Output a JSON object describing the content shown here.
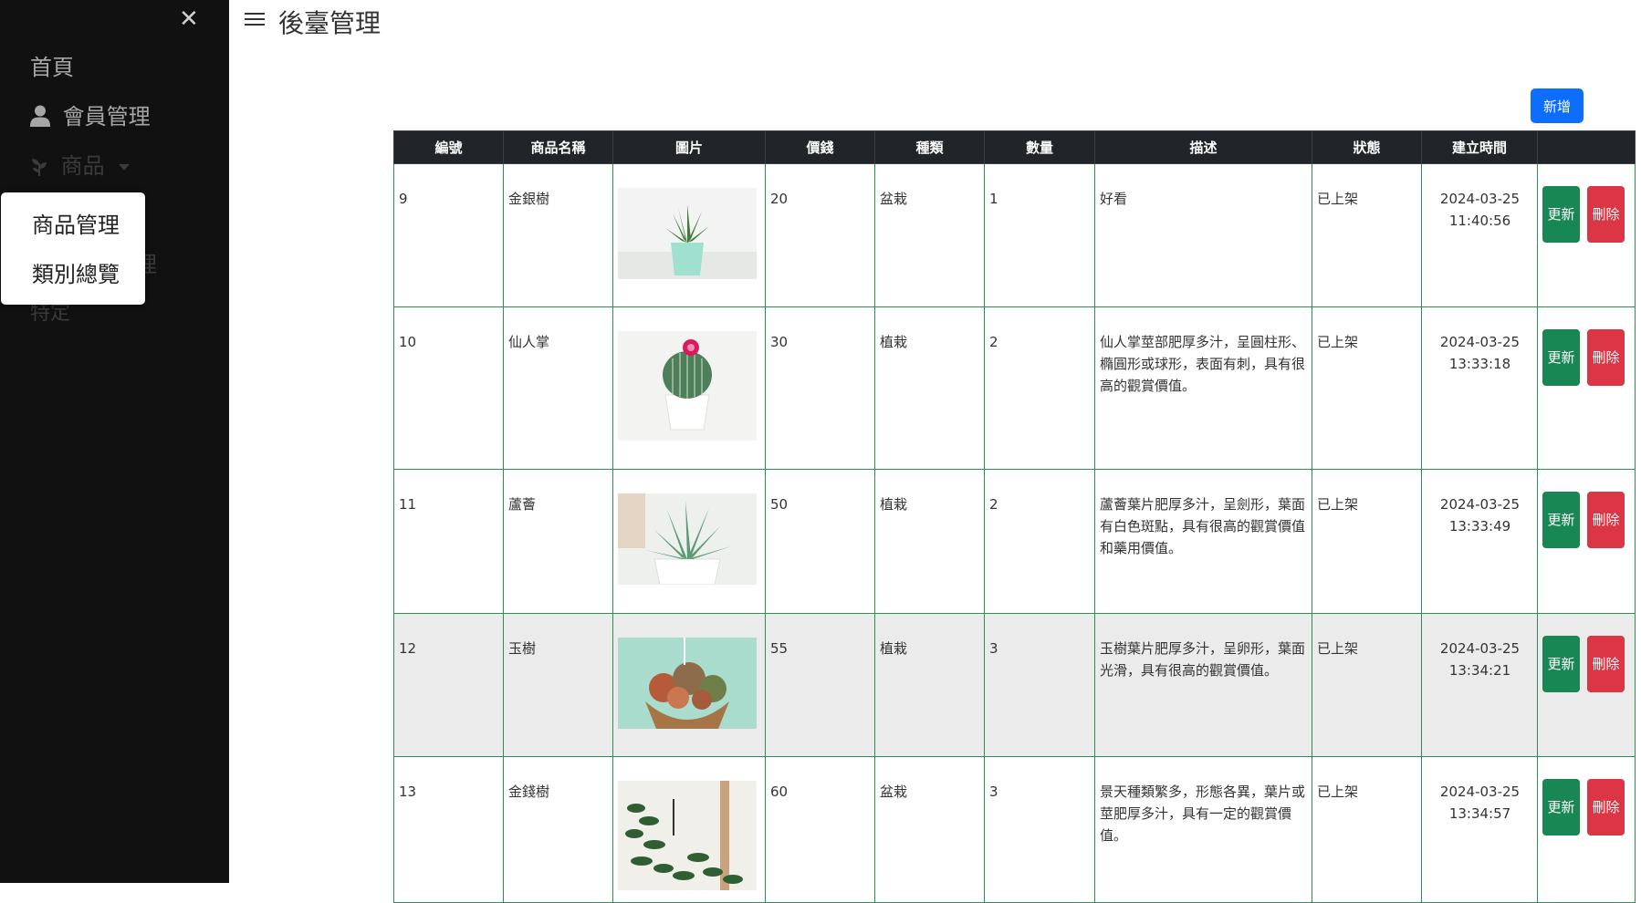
{
  "sidebar": {
    "close_symbol": "✕",
    "home": "首頁",
    "member": "會員管理",
    "product": "商品",
    "hidden_a": "理",
    "hidden_b": "特定",
    "dropdown": [
      "商品管理",
      "類別總覽"
    ]
  },
  "header": {
    "title": "後臺管理"
  },
  "toolbar": {
    "add_label": "新增"
  },
  "table": {
    "columns": [
      "編號",
      "商品名稱",
      "圖片",
      "價錢",
      "種類",
      "數量",
      "描述",
      "狀態",
      "建立時間",
      ""
    ],
    "update_label": "更新",
    "delete_label": "刪除",
    "rows": [
      {
        "id": "9",
        "name": "金銀樹",
        "image": "aloe-in-mint-pot",
        "price": "20",
        "category": "盆栽",
        "qty": "1",
        "desc": "好看",
        "status": "已上架",
        "date": "2024-03-25",
        "time": "11:40:56"
      },
      {
        "id": "10",
        "name": "仙人掌",
        "image": "cactus-with-pink-flower",
        "price": "30",
        "category": "植栽",
        "qty": "2",
        "desc": "仙人掌莖部肥厚多汁，呈圓柱形、橢圓形或球形，表面有刺，具有很高的觀賞價值。",
        "status": "已上架",
        "date": "2024-03-25",
        "time": "13:33:18"
      },
      {
        "id": "11",
        "name": "蘆薈",
        "image": "aloe-in-white-pot",
        "price": "50",
        "category": "植栽",
        "qty": "2",
        "desc": "蘆薈葉片肥厚多汁，呈劍形，葉面有白色斑點，具有很高的觀賞價值和藥用價值。",
        "status": "已上架",
        "date": "2024-03-25",
        "time": "13:33:49"
      },
      {
        "id": "12",
        "name": "玉樹",
        "image": "succulents-in-hanging-pot",
        "price": "55",
        "category": "植栽",
        "qty": "3",
        "desc": "玉樹葉片肥厚多汁，呈卵形，葉面光滑，具有很高的觀賞價值。",
        "status": "已上架",
        "date": "2024-03-25",
        "time": "13:34:21"
      },
      {
        "id": "13",
        "name": "金錢樹",
        "image": "zz-plant",
        "price": "60",
        "category": "盆栽",
        "qty": "3",
        "desc": "景天種類繁多，形態各異，葉片或莖肥厚多汁，具有一定的觀賞價值。",
        "status": "已上架",
        "date": "2024-03-25",
        "time": "13:34:57"
      }
    ]
  },
  "colors": {
    "sidebar_bg": "#111111",
    "primary": "#0d6efd",
    "success": "#198754",
    "danger": "#dc3545",
    "table_header": "#212529",
    "cell_border": "#2e8b57"
  }
}
